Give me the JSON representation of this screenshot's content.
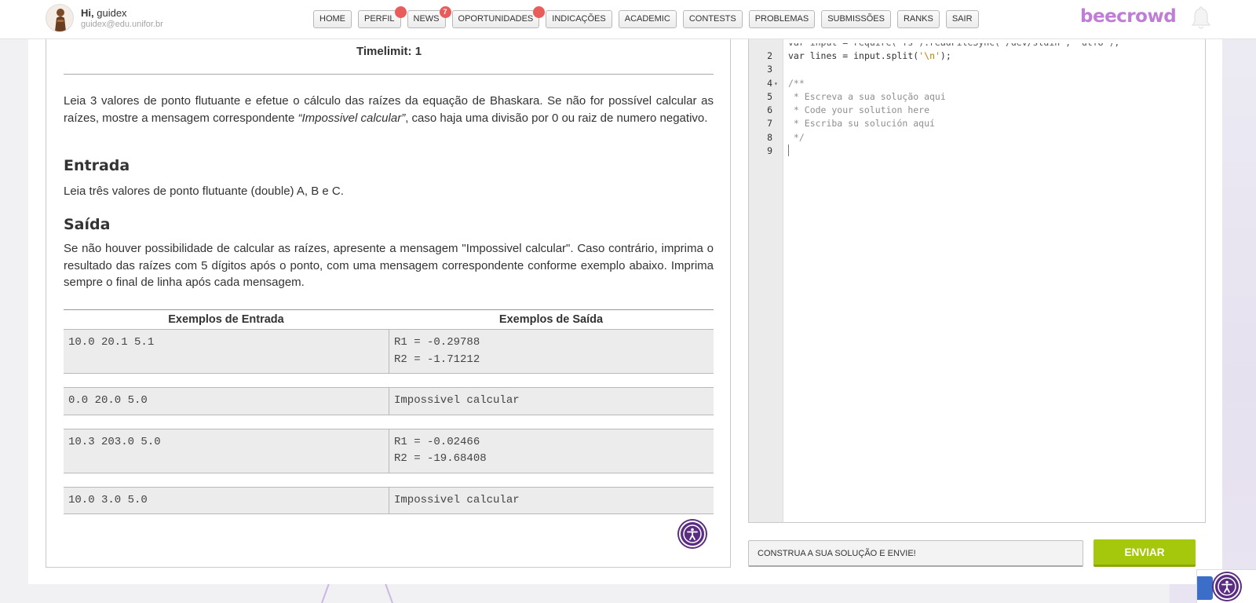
{
  "header": {
    "greeting_prefix": "Hi,",
    "username": "guidex",
    "email": "guidex@edu.unifor.br",
    "brand": "beecrowd",
    "nav": [
      {
        "label": "HOME",
        "badge": ""
      },
      {
        "label": "PERFIL",
        "badge": ""
      },
      {
        "label": "NEWS",
        "badge": "7"
      },
      {
        "label": "OPORTUNIDADES",
        "badge": ""
      },
      {
        "label": "INDICAÇÕES",
        "badge": ""
      },
      {
        "label": "ACADEMIC",
        "badge": ""
      },
      {
        "label": "CONTESTS",
        "badge": ""
      },
      {
        "label": "PROBLEMAS",
        "badge": ""
      },
      {
        "label": "SUBMISSÕES",
        "badge": ""
      },
      {
        "label": "RANKS",
        "badge": ""
      },
      {
        "label": "SAIR",
        "badge": ""
      }
    ]
  },
  "problem": {
    "timelimit": "Timelimit: 1",
    "description_part1": "Leia 3 valores de ponto flutuante e efetue o cálculo das raízes da equação de Bhaskara. Se não for possível calcular as raízes, mostre a mensagem correspondente ",
    "description_italic": "“Impossivel calcular”",
    "description_part2": ", caso haja uma divisão por 0 ou raiz de numero negativo.",
    "input_title": "Entrada",
    "input_text": "Leia três valores de ponto flutuante (double) A, B e C.",
    "output_title": "Saída",
    "output_text": "Se não houver possibilidade de calcular as raízes, apresente a mensagem \"Impossivel calcular\". Caso contrário, imprima o resultado das raízes com 5 dígitos após o ponto, com uma mensagem correspondente conforme exemplo abaixo. Imprima sempre o final de linha após cada mensagem.",
    "examples_input_header": "Exemplos de Entrada",
    "examples_output_header": "Exemplos de Saída",
    "examples": [
      {
        "input": [
          "10.0 20.1 5.1"
        ],
        "output": [
          "R1 = -0.29788",
          "R2 = -1.71212"
        ]
      },
      {
        "input": [
          "0.0 20.0 5.0"
        ],
        "output": [
          "Impossivel calcular"
        ]
      },
      {
        "input": [
          "10.3 203.0 5.0"
        ],
        "output": [
          "R1 = -0.02466",
          "R2 = -19.68408"
        ]
      },
      {
        "input": [
          "10.0 3.0 5.0"
        ],
        "output": [
          "Impossivel calcular"
        ]
      }
    ]
  },
  "editor": {
    "lines": [
      {
        "n": "2",
        "fold": "",
        "parts": [
          [
            "kw",
            "var "
          ],
          [
            "",
            "lines "
          ],
          [
            "",
            "= "
          ],
          [
            "",
            "input."
          ],
          [
            "fn",
            "split"
          ],
          [
            "",
            "("
          ],
          [
            "str",
            "'\\n'"
          ],
          [
            "",
            ");"
          ]
        ]
      },
      {
        "n": "3",
        "fold": "",
        "parts": []
      },
      {
        "n": "4",
        "fold": "▾",
        "parts": [
          [
            "cm",
            "/**"
          ]
        ]
      },
      {
        "n": "5",
        "fold": "",
        "parts": [
          [
            "cm",
            " * Escreva a sua solução aqui"
          ]
        ]
      },
      {
        "n": "6",
        "fold": "",
        "parts": [
          [
            "cm",
            " * Code your solution here"
          ]
        ]
      },
      {
        "n": "7",
        "fold": "",
        "parts": [
          [
            "cm",
            " * Escriba su solución aquí"
          ]
        ]
      },
      {
        "n": "8",
        "fold": "",
        "parts": [
          [
            "cm",
            " */"
          ]
        ]
      },
      {
        "n": "9",
        "fold": "",
        "parts": []
      }
    ],
    "submit_placeholder": "CONSTRUA A SUA SOLUÇÃO E ENVIE!",
    "send_label": "ENVIAR"
  }
}
